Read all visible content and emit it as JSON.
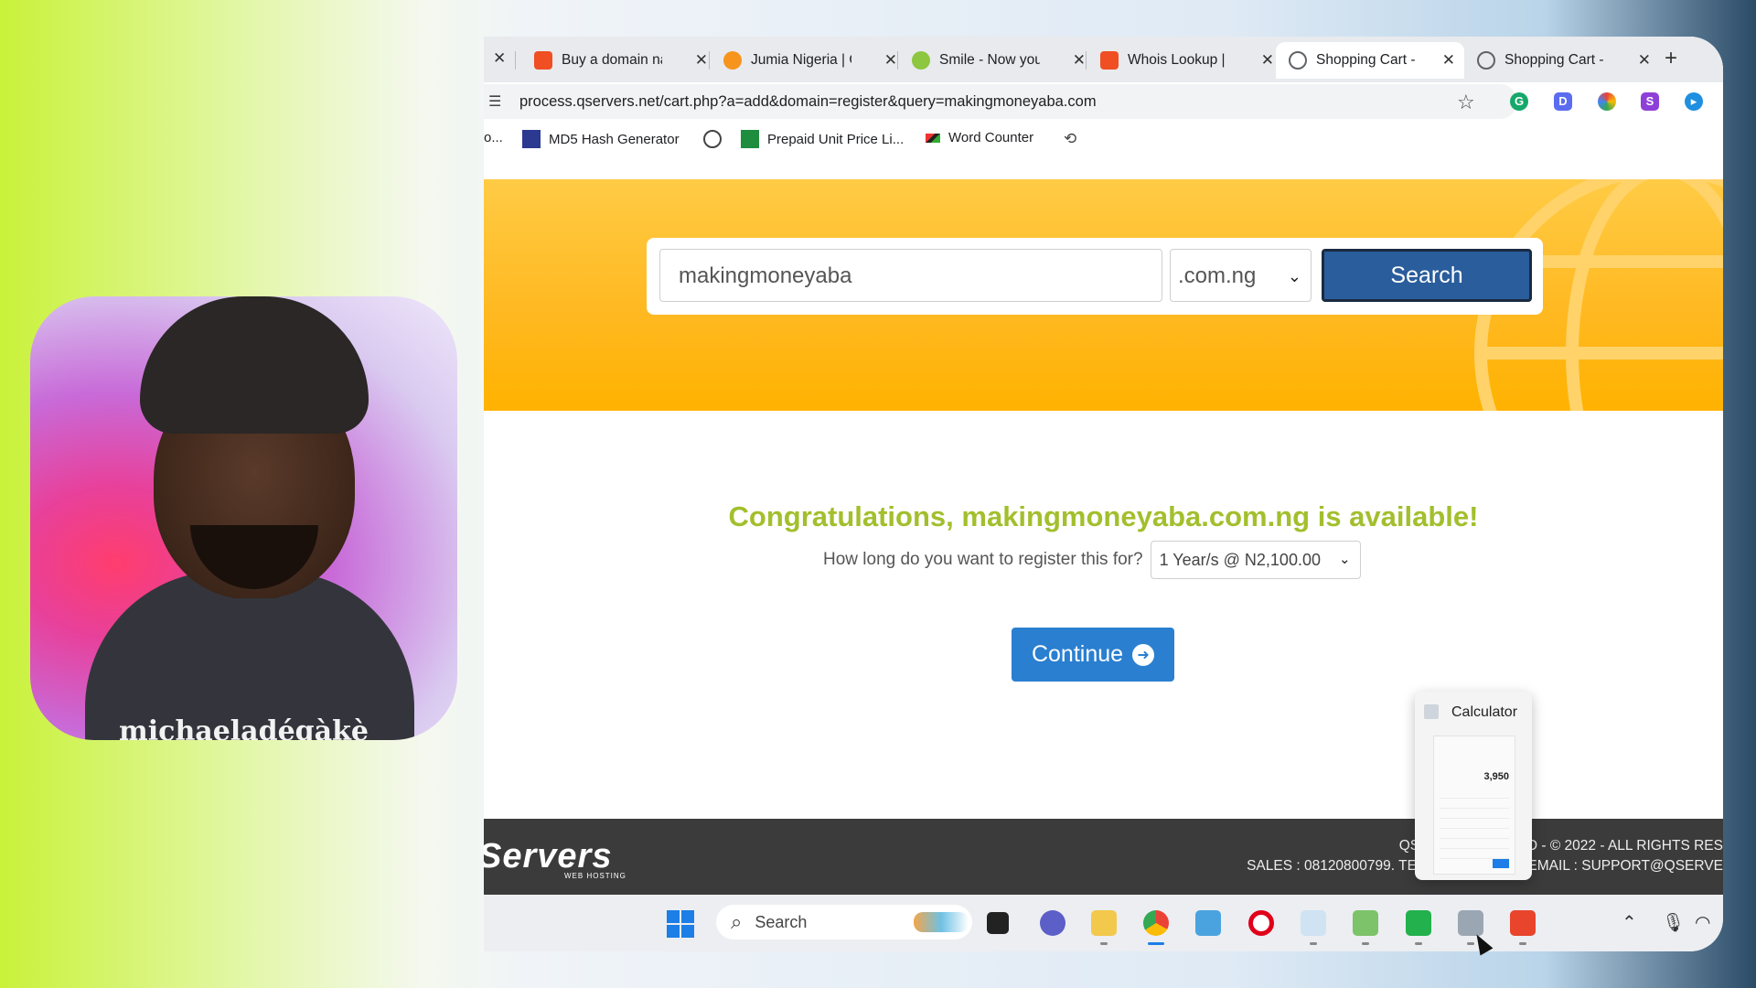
{
  "webcam": {
    "caption": "michaeladégàkè"
  },
  "browser": {
    "tabs": [
      {
        "title": "Buy a domain na",
        "favicon_color": "#f04e23"
      },
      {
        "title": "Jumia Nigeria | C",
        "favicon_color": "#f7941d"
      },
      {
        "title": "Smile - Now you",
        "favicon_color": "#8dc63f"
      },
      {
        "title": "Whois Lookup |",
        "favicon_color": "#f04e23"
      },
      {
        "title": "Shopping Cart -",
        "favicon_color": "#5f6368",
        "active": true
      },
      {
        "title": "Shopping Cart -",
        "favicon_color": "#5f6368"
      }
    ],
    "close_glyph": "✕",
    "new_tab_glyph": "+",
    "url": "process.qservers.net/cart.php?a=add&domain=register&query=makingmoneyaba.com",
    "bookmarks": [
      {
        "label": "o..."
      },
      {
        "label": "MD5 Hash Generator"
      },
      {
        "label": "Prepaid Unit Price Li..."
      },
      {
        "label": "Word Counter"
      }
    ]
  },
  "search": {
    "domain_value": "makingmoneyaba",
    "tld_value": ".com.ng",
    "search_label": "Search"
  },
  "result": {
    "congrats": "Congratulations, makingmoneyaba.com.ng is available!",
    "question": "How long do you want to register this for?",
    "period_value": "1 Year/s @ N2,100.00",
    "continue_label": "Continue"
  },
  "footer": {
    "logo": "Servers",
    "logo_sub": "WEB HOSTING",
    "line1": "QSERVERS LIMITED - © 2022 - ALL RIGHTS RES",
    "line2": "SALES : 08120800799. TECH : 081878819. EMAIL : SUPPORT@QSERVE"
  },
  "taskbar": {
    "search_label": "Search",
    "calculator_popup": {
      "title": "Calculator",
      "display_value": "3,950"
    }
  },
  "colors": {
    "hero_yellow": "#ffb81f",
    "search_button": "#2a5d9c",
    "continue_button": "#2a7fd0",
    "congrats_green": "#a2bf2d",
    "footer_bg": "#3b3b3b"
  }
}
